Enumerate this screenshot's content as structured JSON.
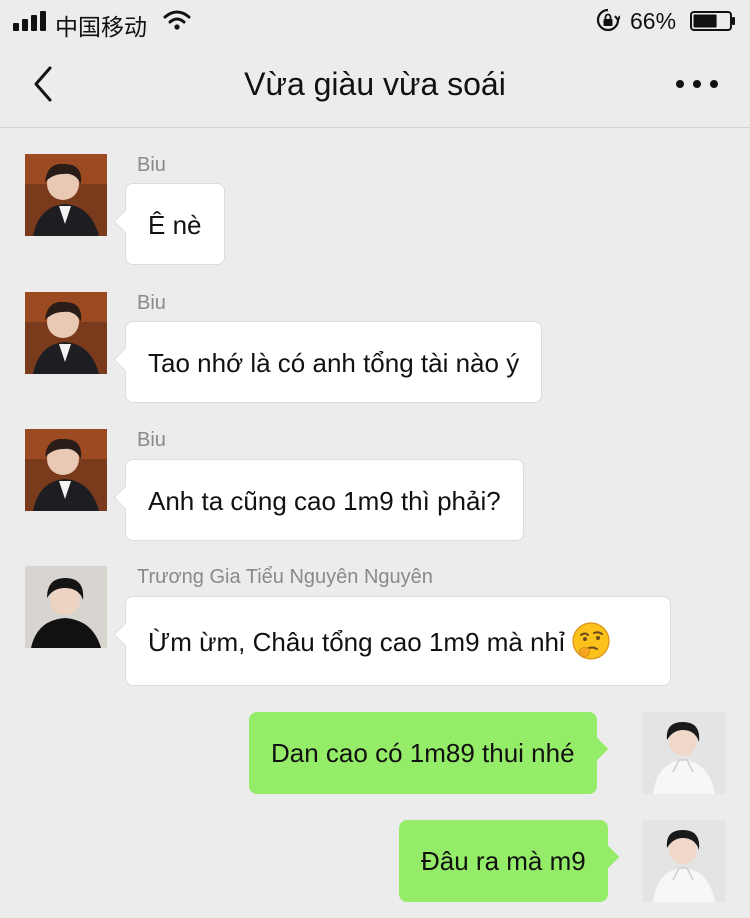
{
  "status_bar": {
    "carrier": "中国移动",
    "battery_percent": "66%",
    "battery_level": 0.66
  },
  "header": {
    "title": "Vừa giàu vừa soái"
  },
  "messages": [
    {
      "sender": "Biu",
      "text": "Ê nè",
      "direction": "incoming"
    },
    {
      "sender": "Biu",
      "text": "Tao nhớ là có anh tổng tài nào ý",
      "direction": "incoming"
    },
    {
      "sender": "Biu",
      "text": "Anh ta cũng cao 1m9 thì phải?",
      "direction": "incoming"
    },
    {
      "sender": "Trương Gia Tiểu Nguyên Nguyên",
      "text": "Ừm ừm, Châu tổng cao 1m9 mà nhỉ",
      "emoji": "thinking-face-emoji",
      "direction": "incoming"
    },
    {
      "text": "Dan cao có 1m89 thui nhé",
      "direction": "outgoing"
    },
    {
      "text": "Đâu ra mà m9",
      "direction": "outgoing"
    }
  ],
  "colors": {
    "background": "#ececec",
    "incoming_bubble": "#ffffff",
    "outgoing_bubble": "#95ec69",
    "sender_name": "#8a8a8a"
  },
  "icons": [
    "signal-icon",
    "wifi-icon",
    "rotation-lock-icon",
    "battery-icon",
    "back-chevron-icon",
    "more-dots-icon"
  ]
}
